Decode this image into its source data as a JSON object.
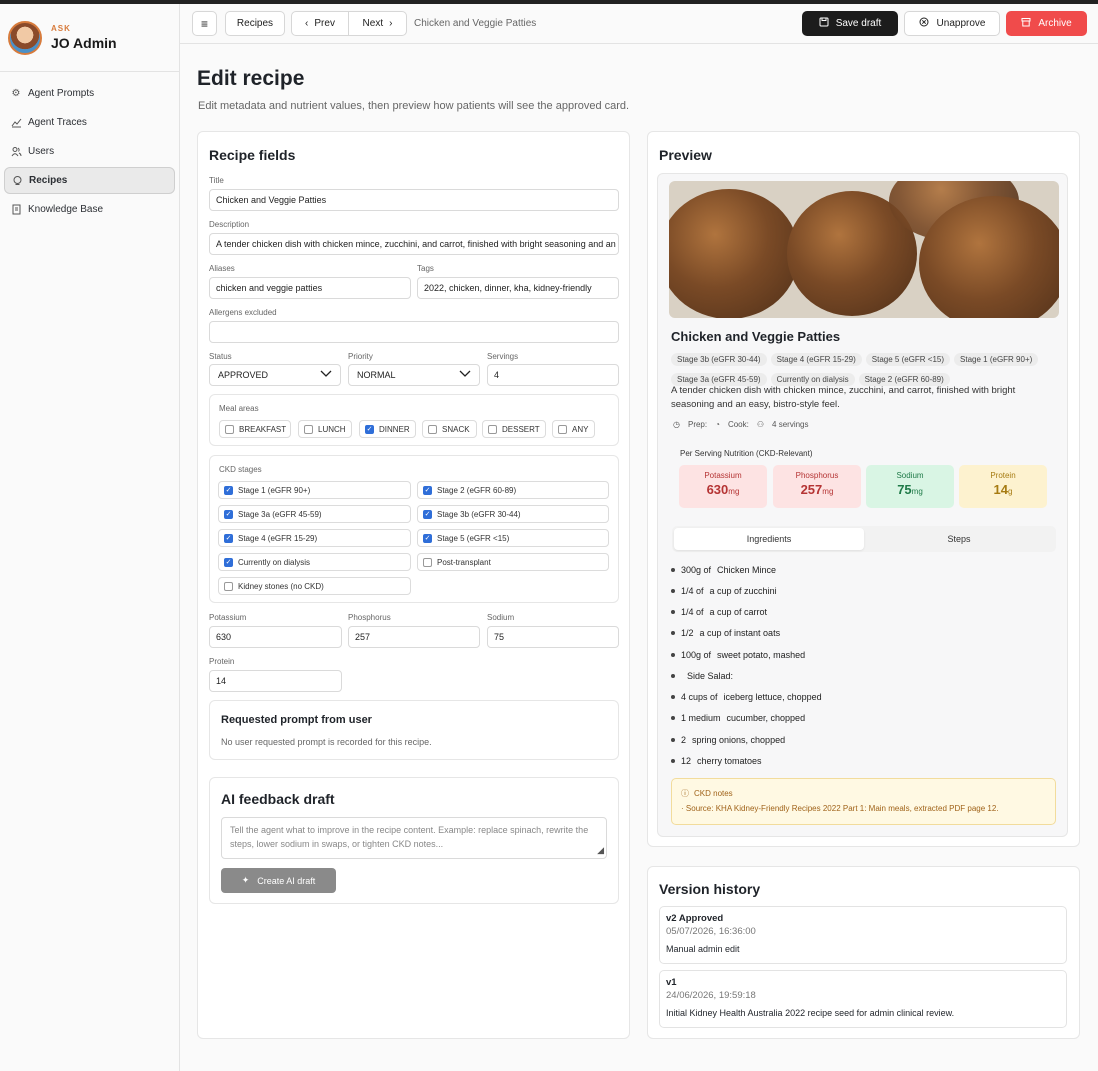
{
  "brand": {
    "small": "ASK",
    "name": "JO Admin"
  },
  "sidebar": {
    "items": [
      {
        "label": "Agent Prompts",
        "icon": "gear-icon"
      },
      {
        "label": "Agent Traces",
        "icon": "chart-icon"
      },
      {
        "label": "Users",
        "icon": "users-icon"
      },
      {
        "label": "Recipes",
        "icon": "chef-icon"
      },
      {
        "label": "Knowledge Base",
        "icon": "book-icon"
      }
    ]
  },
  "topbar": {
    "recipes": "Recipes",
    "prev": "Prev",
    "next": "Next",
    "breadcrumb": "Chicken and Veggie Patties",
    "save": "Save draft",
    "unapprove": "Unapprove",
    "archive": "Archive"
  },
  "page": {
    "title": "Edit recipe",
    "subtitle": "Edit metadata and nutrient values, then preview how patients will see the approved card."
  },
  "form": {
    "heading": "Recipe fields",
    "title_label": "Title",
    "title_value": "Chicken and Veggie Patties",
    "desc_label": "Description",
    "desc_value": "A tender chicken dish with chicken mince, zucchini, and carrot, finished with bright seasoning and an easy, bistro-style feel.",
    "aliases_label": "Aliases",
    "aliases_value": "chicken and veggie patties",
    "tags_label": "Tags",
    "tags_value": "2022, chicken, dinner, kha, kidney-friendly",
    "allergens_label": "Allergens excluded",
    "allergens_value": "",
    "status_label": "Status",
    "status_value": "APPROVED",
    "priority_label": "Priority",
    "priority_value": "NORMAL",
    "servings_label": "Servings",
    "servings_value": "4",
    "meal_label": "Meal areas",
    "meals": [
      {
        "label": "BREAKFAST",
        "checked": false
      },
      {
        "label": "LUNCH",
        "checked": false
      },
      {
        "label": "DINNER",
        "checked": true
      },
      {
        "label": "SNACK",
        "checked": false
      },
      {
        "label": "DESSERT",
        "checked": false
      },
      {
        "label": "ANY",
        "checked": false
      }
    ],
    "ckd_label": "CKD stages",
    "ckd": [
      {
        "label": "Stage 1 (eGFR 90+)",
        "checked": true
      },
      {
        "label": "Stage 2 (eGFR 60-89)",
        "checked": true
      },
      {
        "label": "Stage 3a (eGFR 45-59)",
        "checked": true
      },
      {
        "label": "Stage 3b (eGFR 30-44)",
        "checked": true
      },
      {
        "label": "Stage 4 (eGFR 15-29)",
        "checked": true
      },
      {
        "label": "Stage 5 (eGFR <15)",
        "checked": true
      },
      {
        "label": "Currently on dialysis",
        "checked": true
      },
      {
        "label": "Post-transplant",
        "checked": false
      },
      {
        "label": "Kidney stones (no CKD)",
        "checked": false
      }
    ],
    "potassium_label": "Potassium",
    "potassium_value": "630",
    "phosphorus_label": "Phosphorus",
    "phosphorus_value": "257",
    "sodium_label": "Sodium",
    "sodium_value": "75",
    "protein_label": "Protein",
    "protein_value": "14",
    "requested_title": "Requested prompt from user",
    "requested_text": "No user requested prompt is recorded for this recipe.",
    "ai_title": "AI feedback draft",
    "ai_placeholder": "Tell the agent what to improve in the recipe content. Example: replace spinach, rewrite the steps, lower sodium in swaps, or tighten CKD notes...",
    "ai_button": "Create AI draft"
  },
  "preview": {
    "heading": "Preview",
    "recipe_title": "Chicken and Veggie Patties",
    "tags": [
      "Stage 3b (eGFR 30-44)",
      "Stage 4 (eGFR 15-29)",
      "Stage 5 (eGFR <15)",
      "Stage 1 (eGFR 90+)",
      "Stage 3a (eGFR 45-59)",
      "Currently on dialysis",
      "Stage 2 (eGFR 60-89)"
    ],
    "description": "A tender chicken dish with chicken mince, zucchini, and carrot, finished with bright seasoning and an easy, bistro-style feel.",
    "prep": "Prep:",
    "cook": "Cook:",
    "servings": "4 servings",
    "nutrition_title": "Per Serving Nutrition (CKD-Relevant)",
    "nutrients": [
      {
        "name": "Potassium",
        "value": "630",
        "unit": "mg",
        "bg": "#fde3e3",
        "fg": "#b53434"
      },
      {
        "name": "Phosphorus",
        "value": "257",
        "unit": "mg",
        "bg": "#fde3e3",
        "fg": "#b53434"
      },
      {
        "name": "Sodium",
        "value": "75",
        "unit": "mg",
        "bg": "#d9f5e4",
        "fg": "#1f7a48"
      },
      {
        "name": "Protein",
        "value": "14",
        "unit": "g",
        "bg": "#fdf2cf",
        "fg": "#a67b12"
      }
    ],
    "tab_ingredients": "Ingredients",
    "tab_steps": "Steps",
    "ingredients": [
      {
        "qty": "300g of",
        "item": "Chicken Mince"
      },
      {
        "qty": "1/4 of",
        "item": "a cup of zucchini"
      },
      {
        "qty": "1/4 of",
        "item": "a cup of carrot"
      },
      {
        "qty": "1/2",
        "item": "a cup of instant oats"
      },
      {
        "qty": "100g of",
        "item": "sweet potato, mashed"
      },
      {
        "qty": "",
        "item": "Side Salad:"
      },
      {
        "qty": "4 cups of",
        "item": "iceberg lettuce, chopped"
      },
      {
        "qty": "1 medium",
        "item": "cucumber, chopped"
      },
      {
        "qty": "2",
        "item": "spring onions, chopped"
      },
      {
        "qty": "12",
        "item": "cherry tomatoes"
      }
    ],
    "ckd_notes_title": "CKD notes",
    "ckd_notes_text": "Source: KHA Kidney-Friendly Recipes 2022 Part 1: Main meals, extracted PDF page 12."
  },
  "history": {
    "heading": "Version history",
    "items": [
      {
        "version": "v2 Approved",
        "date": "05/07/2026, 16:36:00",
        "note": "Manual admin edit"
      },
      {
        "version": "v1",
        "date": "24/06/2026, 19:59:18",
        "note": "Initial Kidney Health Australia 2022 recipe seed for admin clinical review."
      }
    ]
  },
  "colors": {
    "accent": "#2f6ed8",
    "danger": "#f04b4b",
    "dark": "#1c1c1c"
  }
}
